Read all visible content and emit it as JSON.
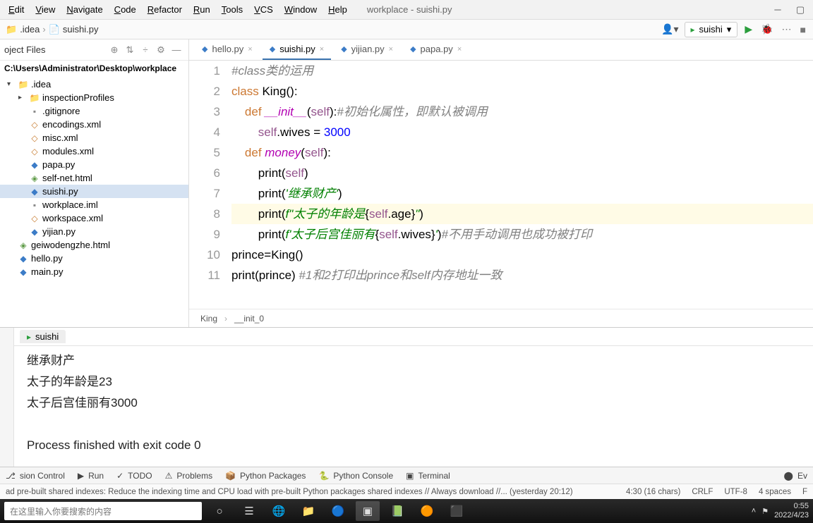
{
  "menubar": {
    "items": [
      "Edit",
      "View",
      "Navigate",
      "Code",
      "Refactor",
      "Run",
      "Tools",
      "VCS",
      "Window",
      "Help"
    ],
    "title": "workplace - suishi.py"
  },
  "navbar": {
    "crumb1": ".idea",
    "crumb2": "suishi.py",
    "run_config": "suishi"
  },
  "sidebar": {
    "header": "oject Files",
    "path": "C:\\Users\\Administrator\\Desktop\\workplace",
    "items": [
      {
        "name": ".idea",
        "type": "folder",
        "expand": true,
        "level": 1,
        "open": true
      },
      {
        "name": "inspectionProfiles",
        "type": "folder",
        "expand": true,
        "level": 2
      },
      {
        "name": ".gitignore",
        "type": "txt",
        "level": 2
      },
      {
        "name": "encodings.xml",
        "type": "xml",
        "level": 2
      },
      {
        "name": "misc.xml",
        "type": "xml",
        "level": 2
      },
      {
        "name": "modules.xml",
        "type": "xml",
        "level": 2
      },
      {
        "name": "papa.py",
        "type": "py",
        "level": 2
      },
      {
        "name": "self-net.html",
        "type": "html",
        "level": 2
      },
      {
        "name": "suishi.py",
        "type": "py",
        "level": 2,
        "selected": true
      },
      {
        "name": "workplace.iml",
        "type": "txt",
        "level": 2
      },
      {
        "name": "workspace.xml",
        "type": "xml",
        "level": 2
      },
      {
        "name": "yijian.py",
        "type": "py",
        "level": 2
      },
      {
        "name": "geiwodengzhe.html",
        "type": "html",
        "level": 1
      },
      {
        "name": "hello.py",
        "type": "py",
        "level": 1
      },
      {
        "name": "main.py",
        "type": "py",
        "level": 1
      }
    ]
  },
  "tabs": [
    {
      "name": "hello.py"
    },
    {
      "name": "suishi.py",
      "active": true
    },
    {
      "name": "yijian.py"
    },
    {
      "name": "papa.py"
    }
  ],
  "code": {
    "lines": [
      [
        [
          "cmt",
          "#class类的运用"
        ]
      ],
      [
        [
          "kw",
          "class "
        ],
        [
          "var",
          "King():"
        ]
      ],
      [
        [
          "pad",
          "    "
        ],
        [
          "kw",
          "def "
        ],
        [
          "fn",
          "__init__"
        ],
        [
          "op",
          "("
        ],
        [
          "self",
          "self"
        ],
        [
          "op",
          "):"
        ],
        [
          "cmt",
          "#初始化属性，即默认被调用"
        ]
      ],
      [
        [
          "pad",
          "        "
        ],
        [
          "self",
          "self"
        ],
        [
          "op",
          "."
        ],
        [
          "var",
          "wives = "
        ],
        [
          "num",
          "3000"
        ]
      ],
      [
        [
          "pad",
          "    "
        ],
        [
          "kw",
          "def "
        ],
        [
          "fn",
          "money"
        ],
        [
          "op",
          "("
        ],
        [
          "self",
          "self"
        ],
        [
          "op",
          "):"
        ]
      ],
      [
        [
          "pad",
          "        "
        ],
        [
          "var",
          "print("
        ],
        [
          "self",
          "self"
        ],
        [
          "var",
          ")"
        ]
      ],
      [
        [
          "pad",
          "        "
        ],
        [
          "var",
          "print("
        ],
        [
          "str",
          "'继承财产'"
        ],
        [
          "var",
          ")"
        ]
      ],
      [
        [
          "pad",
          "        "
        ],
        [
          "var",
          "print("
        ],
        [
          "str",
          "f\""
        ],
        [
          "str",
          "太子的年龄是"
        ],
        [
          "op",
          "{"
        ],
        [
          "self",
          "self"
        ],
        [
          "op",
          "."
        ],
        [
          "var",
          "age"
        ],
        [
          "op",
          "}"
        ],
        [
          "str",
          "\""
        ],
        [
          "var",
          ")"
        ]
      ],
      [
        [
          "pad",
          "        "
        ],
        [
          "var",
          "print("
        ],
        [
          "str",
          "f'"
        ],
        [
          "str",
          "太子后宫佳丽有"
        ],
        [
          "op",
          "{"
        ],
        [
          "self",
          "self"
        ],
        [
          "op",
          "."
        ],
        [
          "var",
          "wives"
        ],
        [
          "op",
          "}"
        ],
        [
          "str",
          "'"
        ],
        [
          "var",
          ")"
        ],
        [
          "cmt",
          "#不用手动调用也成功被打印"
        ]
      ],
      [
        [
          "var",
          "prince=King()"
        ]
      ],
      [
        [
          "var",
          "print(prince) "
        ],
        [
          "cmt",
          "#1和2打印出prince和self内存地址一致"
        ]
      ]
    ],
    "highlight_line": 8,
    "breadcrumb": [
      "King",
      "__init_0"
    ]
  },
  "run_panel": {
    "tab": "suishi",
    "output": [
      "继承财产",
      "太子的年龄是23",
      "太子后宫佳丽有3000",
      "",
      "Process finished with exit code 0"
    ]
  },
  "bottom_tools": [
    "sion Control",
    "Run",
    "TODO",
    "Problems",
    "Python Packages",
    "Python Console",
    "Terminal"
  ],
  "bottom_right": "Ev",
  "status": {
    "msg": "ad pre-built shared indexes: Reduce the indexing time and CPU load with pre-built Python packages shared indexes // Always download //... (yesterday 20:12)",
    "pos": "4:30 (16 chars)",
    "eol": "CRLF",
    "enc": "UTF-8",
    "indent": "4 spaces",
    "interp": "F"
  },
  "taskbar": {
    "search_placeholder": "在这里输入你要搜索的内容",
    "time": "0:55",
    "date": "2022/4/23"
  }
}
